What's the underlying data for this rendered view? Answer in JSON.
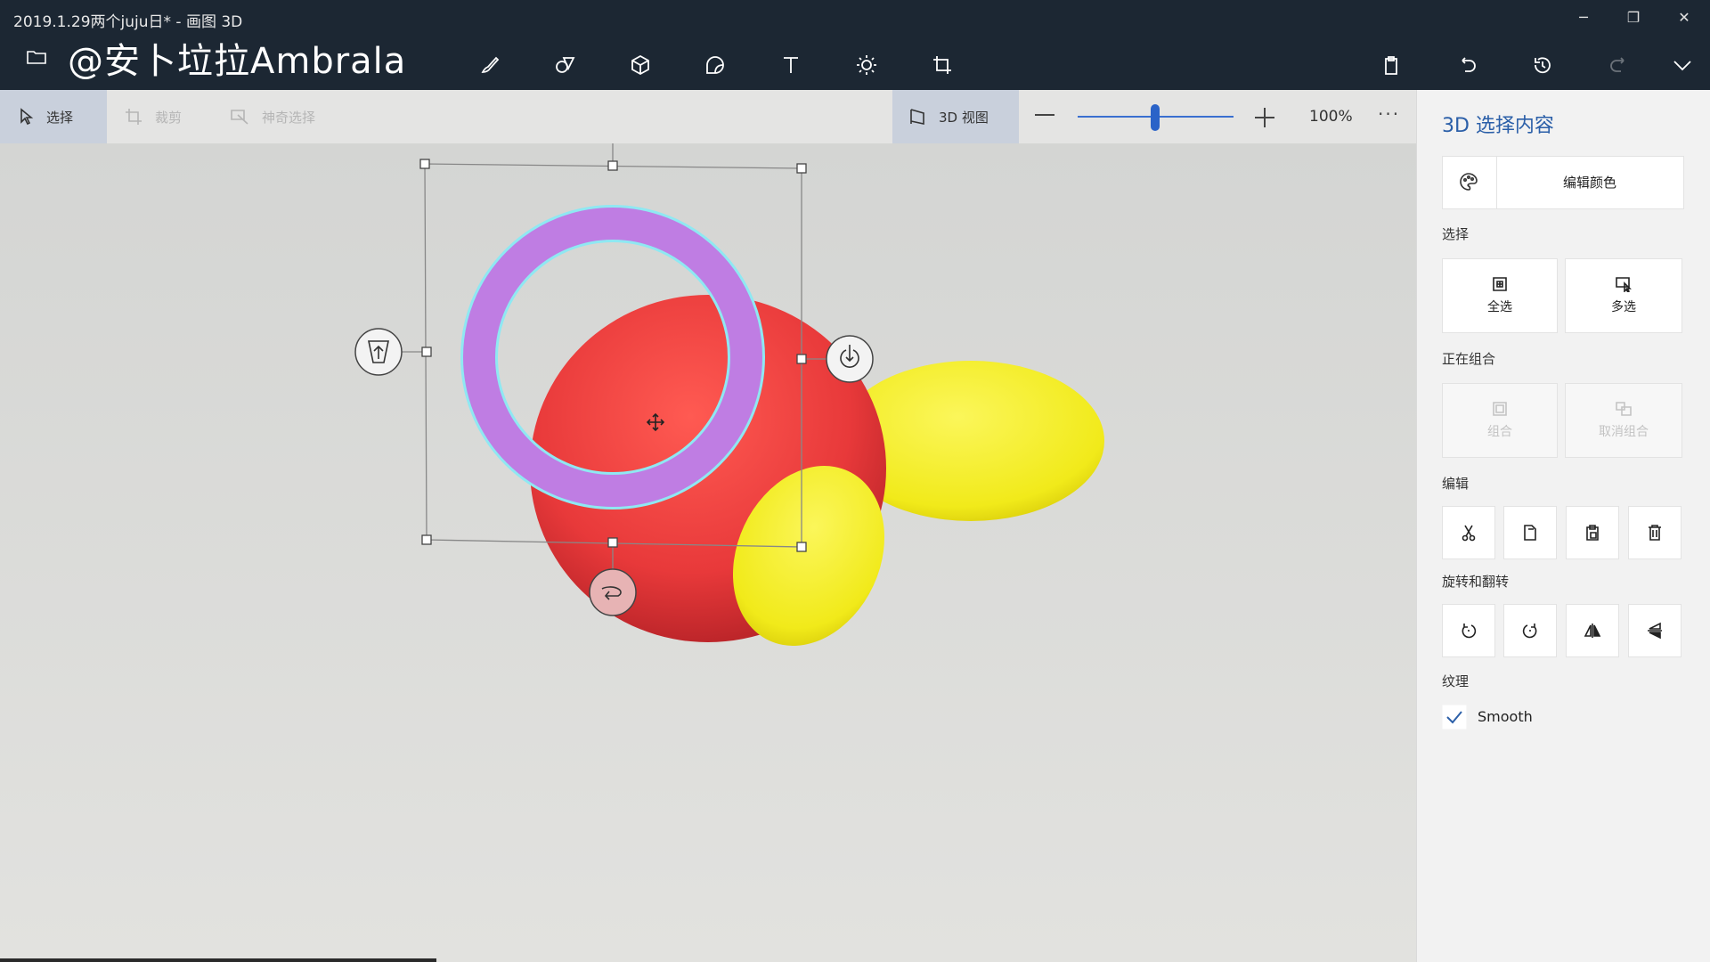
{
  "window": {
    "title": "2019.1.29两个juju日* - 画图 3D",
    "minimize": "─",
    "maximize": "❐",
    "close": "✕"
  },
  "header": {
    "brand": "@安卜垃拉Ambrala",
    "tools": [
      {
        "name": "brushes-icon"
      },
      {
        "name": "2d-shapes-icon"
      },
      {
        "name": "3d-shapes-icon"
      },
      {
        "name": "stickers-icon"
      },
      {
        "name": "text-icon"
      },
      {
        "name": "effects-icon"
      },
      {
        "name": "canvas-icon"
      }
    ],
    "right_tools": [
      {
        "name": "paste-icon"
      },
      {
        "name": "undo-icon"
      },
      {
        "name": "history-icon"
      },
      {
        "name": "redo-icon"
      },
      {
        "name": "expand-chevron-icon"
      }
    ]
  },
  "subbar": {
    "select": "选择",
    "crop": "裁剪",
    "magic_select": "神奇选择",
    "view3d": "3D 视图",
    "zoom_level": "100%",
    "zoom_value": 0.5,
    "more": "···"
  },
  "panel": {
    "title": "3D 选择内容",
    "edit_color": "编辑颜色",
    "select_section": "选择",
    "select_all": "全选",
    "multi_select": "多选",
    "group_section": "正在组合",
    "group": "组合",
    "ungroup": "取消组合",
    "edit_section": "编辑",
    "rotate_section": "旋转和翻转",
    "texture_section": "纹理",
    "smooth": "Smooth",
    "smooth_checked": true
  },
  "colors": {
    "accent": "#2b5fa8",
    "titlebar": "#1c2733",
    "red_body": "#e8393a",
    "yellow": "#f4ee2a",
    "ring": "#bf7de3",
    "ring_outline": "#8fe8f2"
  }
}
